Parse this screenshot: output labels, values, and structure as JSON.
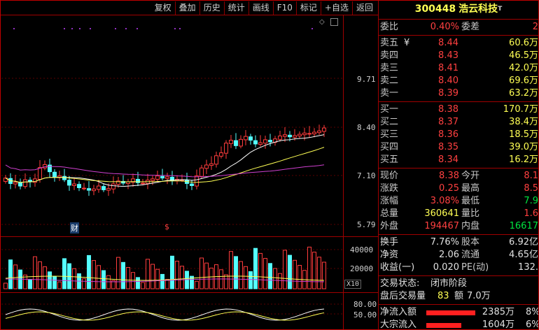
{
  "toolbar": [
    "复权",
    "叠加",
    "历史",
    "统计",
    "画线",
    "F10",
    "标记",
    "+自选",
    "返回"
  ],
  "price_axis": [
    "9.71",
    "8.40",
    "7.10",
    "5.79"
  ],
  "volume_axis": [
    "40000",
    "20000"
  ],
  "volume_unit": "X10",
  "indicator_axis": [
    "80.00",
    "50.00"
  ],
  "markers": {
    "cai": "财",
    "money": "$"
  },
  "stock": {
    "code": "300448",
    "name": "浩云科技",
    "tmark": "T"
  },
  "weibi": {
    "label": "委比",
    "value": "0.40%",
    "label2": "委差",
    "value2": "2"
  },
  "sells": [
    {
      "label": "卖五",
      "mark": "¥",
      "price": "8.44",
      "vol": "60.6万"
    },
    {
      "label": "卖四",
      "mark": "",
      "price": "8.43",
      "vol": "46.5万"
    },
    {
      "label": "卖三",
      "mark": "",
      "price": "8.41",
      "vol": "42.0万"
    },
    {
      "label": "卖二",
      "mark": "",
      "price": "8.40",
      "vol": "69.6万"
    },
    {
      "label": "卖一",
      "mark": "",
      "price": "8.39",
      "vol": "63.2万"
    }
  ],
  "buys": [
    {
      "label": "买一",
      "price": "8.38",
      "vol": "170.7万"
    },
    {
      "label": "买二",
      "price": "8.37",
      "vol": "38.4万"
    },
    {
      "label": "买三",
      "price": "8.36",
      "vol": "18.5万"
    },
    {
      "label": "买四",
      "price": "8.35",
      "vol": "39.0万"
    },
    {
      "label": "买五",
      "price": "8.34",
      "vol": "16.2万"
    }
  ],
  "quote": [
    {
      "l1": "现价",
      "v1": "8.38",
      "c1": "red",
      "l2": "今开",
      "v2": "8.1",
      "c2": "red"
    },
    {
      "l1": "涨跌",
      "v1": "0.25",
      "c1": "red",
      "l2": "最高",
      "v2": "8.5",
      "c2": "red"
    },
    {
      "l1": "涨幅",
      "v1": "3.08%",
      "c1": "red",
      "l2": "最低",
      "v2": "7.9",
      "c2": "green"
    },
    {
      "l1": "总量",
      "v1": "360641",
      "c1": "yellow",
      "l2": "量比",
      "v2": "1.6",
      "c2": "red"
    },
    {
      "l1": "外盘",
      "v1": "194467",
      "c1": "red",
      "l2": "内盘",
      "v2": "16617",
      "c2": "green"
    }
  ],
  "finance": [
    {
      "l1": "换手",
      "v1": "7.76%",
      "l2": "股本",
      "v2": "6.92亿"
    },
    {
      "l1": "净资",
      "v1": "2.06",
      "l2": "流通",
      "v2": "4.65亿"
    },
    {
      "l1": "收益(一)",
      "v1": "0.020",
      "l2": "PE(动)",
      "v2": "132."
    }
  ],
  "status": {
    "label": "交易状态:",
    "value": "闭市阶段"
  },
  "after": {
    "label": "盘后交易量",
    "vol": "83",
    "amt_label": "额",
    "amt": "7.0万"
  },
  "flows": [
    {
      "label": "净流入额",
      "value": "2385万",
      "pct": "8%"
    },
    {
      "label": "大宗流入",
      "value": "1604万",
      "pct": "6%"
    }
  ]
}
